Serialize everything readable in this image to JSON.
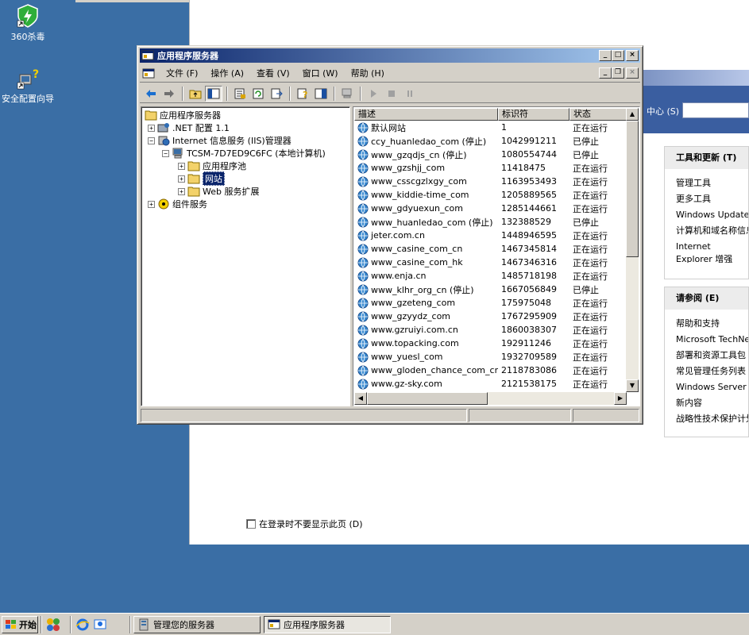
{
  "desktop": {
    "icons": [
      {
        "label": "360杀毒"
      },
      {
        "label": "安全配置向导"
      }
    ]
  },
  "background_window": {
    "search_label": "中心 (S)",
    "panels": [
      {
        "header": "工具和更新 (T)",
        "items": [
          "管理工具",
          "更多工具",
          "Windows Update",
          "计算机和域名称信息",
          "Internet Explorer 增强的安全配置"
        ]
      },
      {
        "header": "请参阅 (E)",
        "items": [
          "帮助和支持",
          "Microsoft TechNet",
          "部署和资源工具包",
          "常见管理任务列表",
          "Windows Server 社区",
          "新内容",
          "战略性技术保护计划"
        ]
      }
    ],
    "dont_show_label": "在登录时不要显示此页 (D)"
  },
  "window": {
    "title": "应用程序服务器",
    "menu": [
      "文件 (F)",
      "操作 (A)",
      "查看 (V)",
      "窗口 (W)",
      "帮助 (H)"
    ],
    "tree": [
      {
        "label": "应用程序服务器",
        "level": 0
      },
      {
        "label": ".NET 配置 1.1",
        "level": 1
      },
      {
        "label": "Internet 信息服务 (IIS)管理器",
        "level": 1
      },
      {
        "label": "TCSM-7D7ED9C6FC (本地计算机)",
        "level": 2
      },
      {
        "label": "应用程序池",
        "level": 3
      },
      {
        "label": "网站",
        "level": 3
      },
      {
        "label": "Web 服务扩展",
        "level": 3
      },
      {
        "label": "组件服务",
        "level": 1
      }
    ],
    "columns": [
      "描述",
      "标识符",
      "状态"
    ],
    "sites": [
      {
        "name": "默认网站",
        "id": "1",
        "status": "正在运行"
      },
      {
        "name": "ccy_huanledao_com (停止)",
        "id": "1042991211",
        "status": "已停止"
      },
      {
        "name": "www_gzqdjs_cn (停止)",
        "id": "1080554744",
        "status": "已停止"
      },
      {
        "name": "www_gzshjj_com",
        "id": "11418475",
        "status": "正在运行"
      },
      {
        "name": "www_csscgzlxgy_com",
        "id": "1163953493",
        "status": "正在运行"
      },
      {
        "name": "www_kiddie-time_com",
        "id": "1205889565",
        "status": "正在运行"
      },
      {
        "name": "www_gdyuexun_com",
        "id": "1285144661",
        "status": "正在运行"
      },
      {
        "name": "www_huanledao_com (停止)",
        "id": "132388529",
        "status": "已停止"
      },
      {
        "name": "jeter.com.cn",
        "id": "1448946595",
        "status": "正在运行"
      },
      {
        "name": "www_casine_com_cn",
        "id": "1467345814",
        "status": "正在运行"
      },
      {
        "name": "www_casine_com_hk",
        "id": "1467346316",
        "status": "正在运行"
      },
      {
        "name": "www.enja.cn",
        "id": "1485718198",
        "status": "正在运行"
      },
      {
        "name": "www_klhr_org_cn (停止)",
        "id": "1667056849",
        "status": "已停止"
      },
      {
        "name": "www_gzeteng_com",
        "id": "175975048",
        "status": "正在运行"
      },
      {
        "name": "www_gzyydz_com",
        "id": "1767295909",
        "status": "正在运行"
      },
      {
        "name": "www.gzruiyi.com.cn",
        "id": "1860038307",
        "status": "正在运行"
      },
      {
        "name": "www.topacking.com",
        "id": "192911246",
        "status": "正在运行"
      },
      {
        "name": "www_yuesl_com",
        "id": "1932709589",
        "status": "正在运行"
      },
      {
        "name": "www_gloden_chance_com_cn",
        "id": "2118783086",
        "status": "正在运行"
      },
      {
        "name": "www.gz-sky.com",
        "id": "2121538175",
        "status": "正在运行"
      }
    ]
  },
  "taskbar": {
    "start": "开始",
    "tasks": [
      {
        "label": "管理您的服务器",
        "active": false
      },
      {
        "label": "应用程序服务器",
        "active": true
      }
    ]
  }
}
